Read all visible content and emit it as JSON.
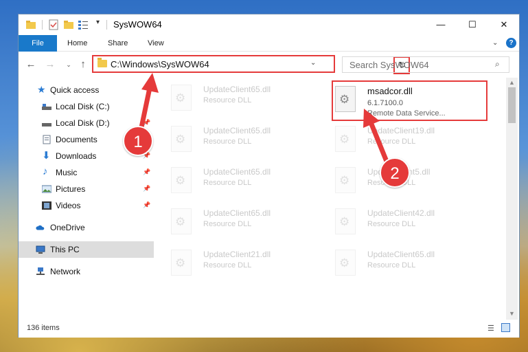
{
  "window": {
    "title": "SysWOW64",
    "controls": {
      "minimize": "—",
      "maximize": "☐",
      "close": "✕"
    }
  },
  "ribbon": {
    "tabs": [
      {
        "label": "File",
        "active": true
      },
      {
        "label": "Home"
      },
      {
        "label": "Share"
      },
      {
        "label": "View"
      }
    ],
    "help": "?"
  },
  "address": {
    "path": "C:\\Windows\\SysWOW64",
    "search_placeholder": "Search SysWOW64"
  },
  "sidebar": {
    "items": [
      {
        "label": "Quick access",
        "icon": "star-icon",
        "pinned": false
      },
      {
        "label": "Local Disk (C:)",
        "icon": "drive-icon",
        "pinned": true
      },
      {
        "label": "Local Disk (D:)",
        "icon": "drive-icon",
        "pinned": true
      },
      {
        "label": "Documents",
        "icon": "documents-icon",
        "pinned": true
      },
      {
        "label": "Downloads",
        "icon": "downloads-icon",
        "pinned": true
      },
      {
        "label": "Music",
        "icon": "music-icon",
        "pinned": true
      },
      {
        "label": "Pictures",
        "icon": "pictures-icon",
        "pinned": true
      },
      {
        "label": "Videos",
        "icon": "videos-icon",
        "pinned": true
      },
      {
        "label": "OneDrive",
        "icon": "cloud-icon",
        "pinned": false
      },
      {
        "label": "This PC",
        "icon": "pc-icon",
        "pinned": false,
        "selected": true
      },
      {
        "label": "Network",
        "icon": "network-icon",
        "pinned": false
      }
    ]
  },
  "files": {
    "left_column": [
      {
        "name": "UpdateClient65.dll",
        "type": "Resource DLL"
      },
      {
        "name": "UpdateClient65.dll",
        "type": "Resource DLL"
      },
      {
        "name": "UpdateClient65.dll",
        "type": "Resource DLL"
      },
      {
        "name": "UpdateClient65.dll",
        "type": "Resource DLL"
      },
      {
        "name": "UpdateClient21.dll",
        "type": "Resource DLL"
      }
    ],
    "right_column": [
      {
        "name": "UpdateClient19.dll",
        "type": "Resource DLL"
      },
      {
        "name": "UpdateClient5.dll",
        "type": "Resource DLL"
      },
      {
        "name": "UpdateClient42.dll",
        "type": "Resource DLL"
      },
      {
        "name": "UpdateClient65.dll",
        "type": "Resource DLL"
      }
    ],
    "highlighted": {
      "name": "msadcor.dll",
      "version": "6.1.7100.0",
      "type": "Remote Data Service..."
    }
  },
  "status": {
    "item_count": "136 items"
  },
  "annotations": {
    "step1": "1",
    "step2": "2",
    "color": "#e53a3a"
  }
}
